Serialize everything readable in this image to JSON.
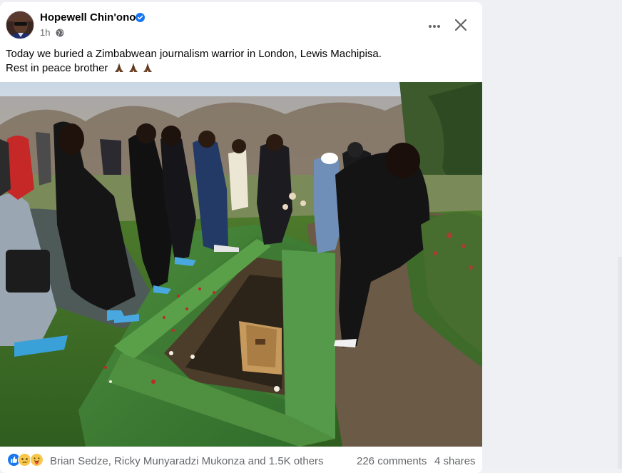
{
  "post": {
    "author": "Hopewell Chin'ono",
    "time": "1h",
    "verified": true,
    "text_line1": "Today we buried a Zimbabwean journalism warrior in London, Lewis Machipisa.",
    "text_line2": "Rest in peace brother",
    "emojis": [
      "folded-hands-emoji",
      "folded-hands-emoji",
      "folded-hands-emoji"
    ]
  },
  "footer": {
    "reactions": [
      "like-reaction-icon",
      "sad-reaction-icon",
      "care-reaction-icon"
    ],
    "reactors": "Brian Sedze, Ricky Munyaradzi Mukonza and 1.5K others",
    "comments": "226 comments",
    "shares": "4 shares"
  },
  "colors": {
    "brand_blue": "#1877f2",
    "text_primary": "#050505",
    "text_secondary": "#65676b",
    "background": "#eef0f3"
  }
}
